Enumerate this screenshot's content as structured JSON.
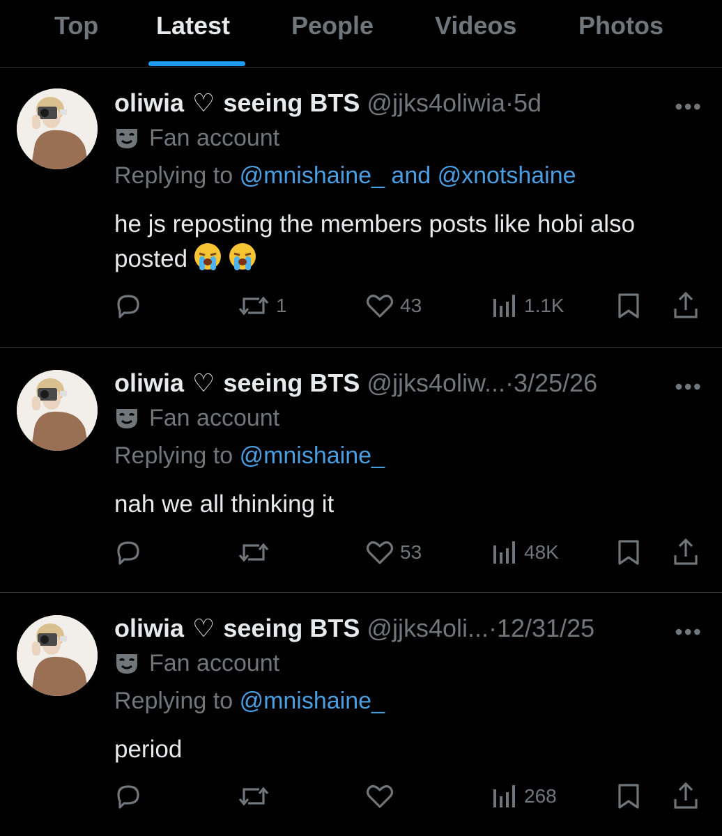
{
  "tabs": [
    {
      "label": "Top"
    },
    {
      "label": "Latest"
    },
    {
      "label": "People"
    },
    {
      "label": "Videos"
    },
    {
      "label": "Photos"
    }
  ],
  "active_tab": "Latest",
  "colors": {
    "accent": "#1d9bf0",
    "mention": "#4a9fe3",
    "muted": "#71767b",
    "text": "#e7e9ea",
    "background": "#000000"
  },
  "tweets": [
    {
      "name_pre": "oliwia",
      "name_heart": "♡",
      "name_post": "seeing BTS",
      "handle": "@jjks4oliwia",
      "separator": "·",
      "time": "5d",
      "label": "Fan account",
      "reply_prefix": "Replying to",
      "reply_to": "@mnishaine_ and @xnotshaine",
      "text": "he js reposting the members posts like hobi also posted",
      "emoji": [
        "loudly-crying-face",
        "loudly-crying-face"
      ],
      "reposts": "1",
      "likes": "43",
      "views": "1.1K"
    },
    {
      "name_pre": "oliwia",
      "name_heart": "♡",
      "name_post": "seeing BTS",
      "handle": "@jjks4oliw...",
      "separator": "·",
      "time": "3/25/26",
      "label": "Fan account",
      "reply_prefix": "Replying to",
      "reply_to": "@mnishaine_",
      "text": "nah we all thinking it",
      "reposts": "",
      "likes": "53",
      "views": "48K"
    },
    {
      "name_pre": "oliwia",
      "name_heart": "♡",
      "name_post": "seeing BTS",
      "handle": "@jjks4oli...",
      "separator": "·",
      "time": "12/31/25",
      "label": "Fan account",
      "reply_prefix": "Replying to",
      "reply_to": "@mnishaine_",
      "text": "period",
      "reposts": "",
      "likes": "",
      "views": "268"
    }
  ],
  "more_glyph": "•••",
  "icons": {
    "reply": "reply-icon",
    "repost": "repost-icon",
    "like": "heart-icon",
    "views": "views-icon",
    "bookmark": "bookmark-icon",
    "share": "share-icon",
    "label": "theater-mask-icon"
  }
}
